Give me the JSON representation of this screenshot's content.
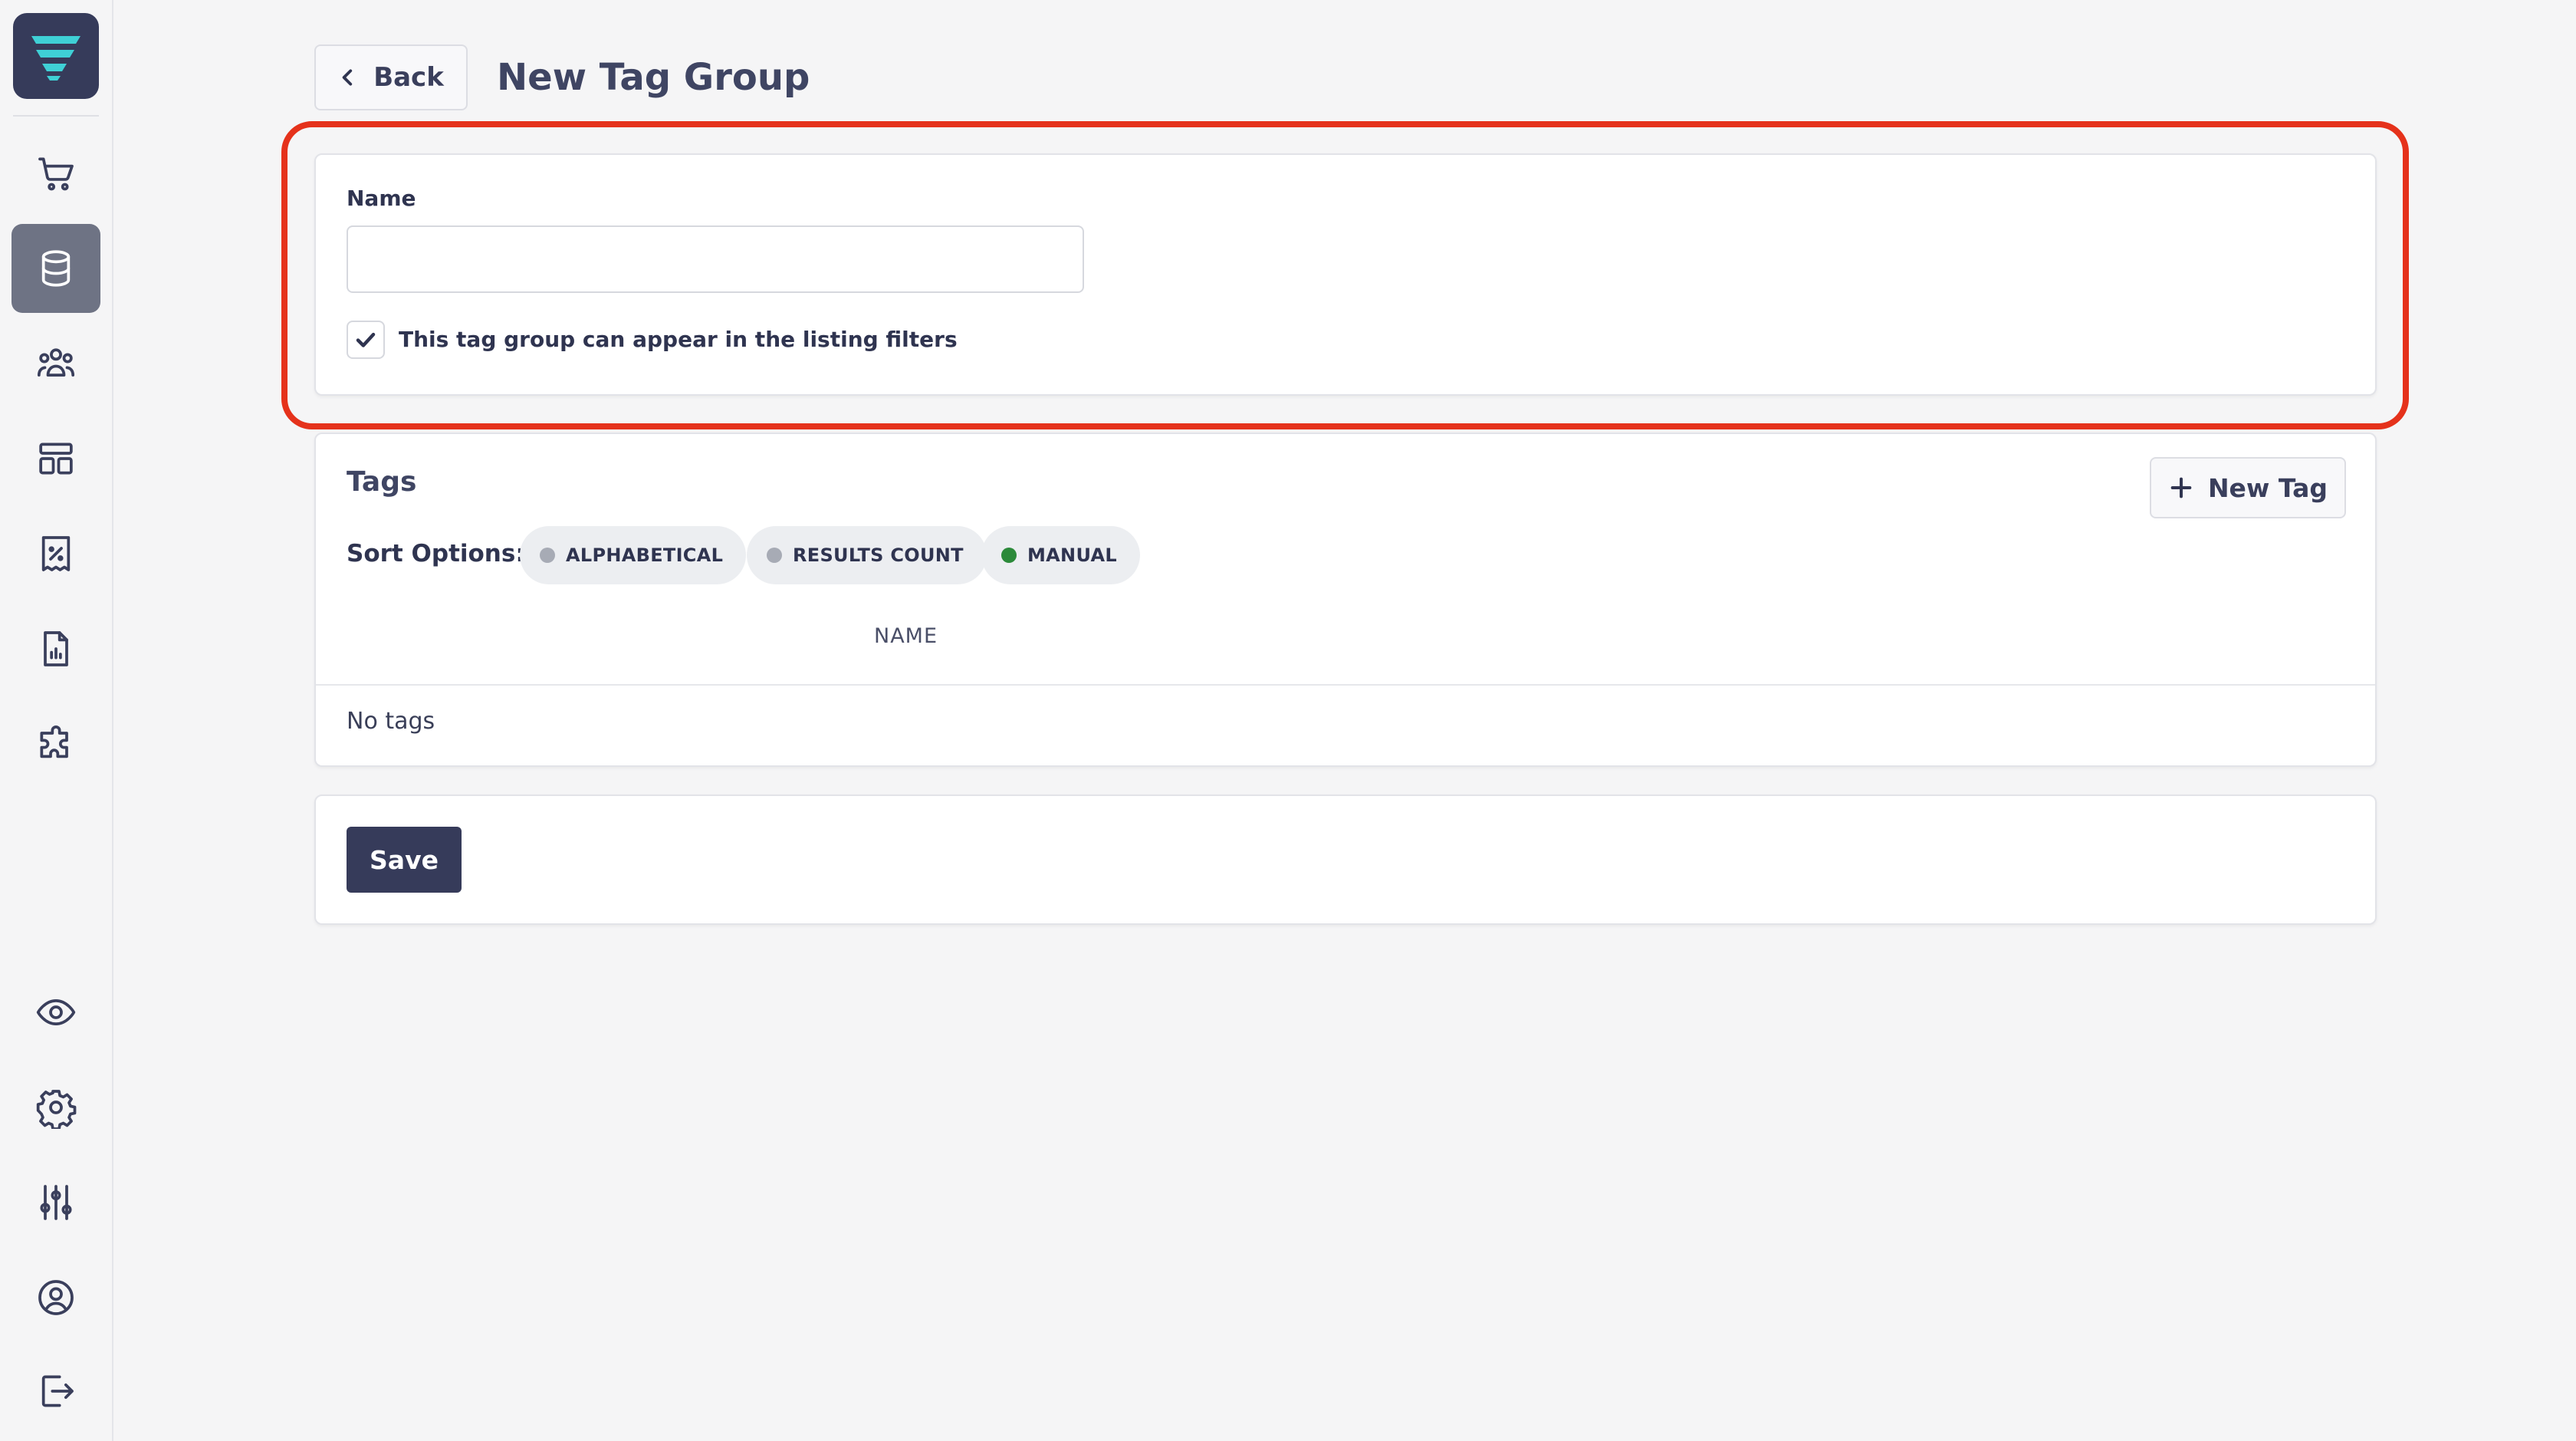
{
  "header": {
    "back_label": "Back",
    "title": "New Tag Group"
  },
  "sidebar": {
    "logo_icon": "brand-logo-icon",
    "items": [
      {
        "icon": "cart-icon",
        "active": false
      },
      {
        "icon": "database-icon",
        "active": true
      },
      {
        "icon": "users-icon",
        "active": false
      },
      {
        "icon": "layout-icon",
        "active": false
      },
      {
        "icon": "receipt-percent-icon",
        "active": false
      },
      {
        "icon": "report-icon",
        "active": false
      },
      {
        "icon": "puzzle-icon",
        "active": false
      },
      {
        "icon": "eye-icon",
        "active": false
      },
      {
        "icon": "gear-icon",
        "active": false
      },
      {
        "icon": "sliders-icon",
        "active": false
      },
      {
        "icon": "user-circle-icon",
        "active": false
      },
      {
        "icon": "logout-icon",
        "active": false
      }
    ]
  },
  "form": {
    "name_label": "Name",
    "name_value": "",
    "name_placeholder": "",
    "filter_checkbox_checked": true,
    "filter_checkbox_label": "This tag group can appear in the listing filters"
  },
  "tags": {
    "title": "Tags",
    "new_tag_label": "New Tag",
    "sort_label": "Sort Options:",
    "sort_options": [
      {
        "label": "ALPHABETICAL",
        "active": false
      },
      {
        "label": "RESULTS COUNT",
        "active": false
      },
      {
        "label": "MANUAL",
        "active": true
      }
    ],
    "column_name": "NAME",
    "empty_text": "No tags"
  },
  "actions": {
    "save_label": "Save"
  },
  "colors": {
    "primary": "#363b5a",
    "sidebar_active": "#6e7384",
    "highlight": "#e5321b",
    "sort_active": "#2c8a3a",
    "sort_inactive": "#a7abb5",
    "logo_accent": "#3fd0d6"
  }
}
